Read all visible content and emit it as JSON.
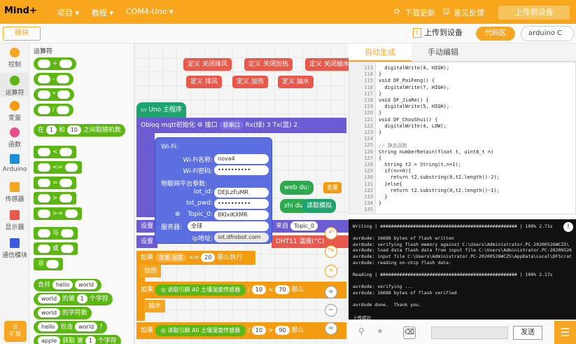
{
  "app": {
    "name": "Mind+",
    "menus": [
      "项目 ▾",
      "教程 ▾",
      "COM4-Uno ▾"
    ],
    "download_update": "下载更新",
    "feedback": "意见反馈",
    "overlay_text": "上传到设备"
  },
  "toolbar": {
    "module_tab": "模块",
    "upload_label": "上传到设备",
    "code_badge": "代码区",
    "board_select": "arduino C"
  },
  "categories": [
    {
      "label": "控制",
      "color": "#f5a623"
    },
    {
      "label": "运算符",
      "color": "#5cb712"
    },
    {
      "label": "变量",
      "color": "#f39c12"
    },
    {
      "label": "函数",
      "color": "#e84c8a"
    },
    {
      "label": "Arduino",
      "color": "#1e90d8"
    },
    {
      "label": "传感器",
      "color": "#f5a623"
    },
    {
      "label": "显示器",
      "color": "#e8594c"
    },
    {
      "label": "通信模块",
      "color": "#3b5bdb"
    }
  ],
  "palette": {
    "section_title": "运算符",
    "ops": [
      "+",
      "-",
      "*",
      "/"
    ],
    "random": {
      "pre": "在",
      "a": "1",
      "mid": "和",
      "b": "10",
      "post": "之间取随机数"
    },
    "compare": [
      "<",
      "<=",
      "=",
      ">",
      ">="
    ],
    "logic": [
      "与",
      "或",
      "非"
    ],
    "strings": {
      "join": {
        "label": "合并",
        "a": "hello",
        "b": "world"
      },
      "letter": {
        "a": "world",
        "mid": "的第",
        "n": "1",
        "post": "个字符"
      },
      "length": {
        "a": "world",
        "post": "的字符数"
      },
      "contains": {
        "a": "hello",
        "mid": "包含",
        "b": "world",
        "post": "?"
      },
      "get": {
        "a": "apple",
        "mid": "获取 第",
        "n": "1",
        "post": "个字符"
      }
    }
  },
  "workspace": {
    "defines": [
      "定义 关闭排风",
      "定义 关闭加热",
      "定义 关闭抽水",
      "定义 排风",
      "定义 加热",
      "定义 抽水"
    ],
    "main_hat": "Uno 主程序",
    "obloq": {
      "label": "Obloq mqtt初始化",
      "port": "接口",
      "serial": "软串口",
      "rx": "Rx(绿)",
      "rx_val": "3",
      "tx": "Tx(蓝)",
      "tx_val": "2"
    },
    "popup": {
      "wifi_title": "Wi-Fi:",
      "wifi_name_label": "Wi-Fi名称:",
      "wifi_name": "nova4",
      "wifi_pass_label": "Wi-Fi密码:",
      "wifi_pass": "••••••••••",
      "iot_title": "物联网平台参数:",
      "iot_id_label": "Iot_id:",
      "iot_id": "DEJLzFuMR",
      "iot_pwd_label": "Iot_pwd:",
      "iot_pwd": "••••••••••",
      "topic_label": "Topic_0:",
      "topic": "8KIxiKXMR",
      "server_label": "服务器:",
      "server": "全球",
      "ip_label": "ip地址:",
      "ip": "iot.dfrobot.com"
    },
    "side_blocks": {
      "web_du": "web du:",
      "var_badge": "变量",
      "zhi_du": "zhi du:",
      "read_analog": "读取模拟",
      "from": "来自",
      "topic0": "Topic_0",
      "dht": "DHT11",
      "temp": "温度(°C)"
    },
    "set1": "设置",
    "set2": "设置",
    "if1": {
      "pre": "如果",
      "var": "变量 温度",
      "op": "<=",
      "val": "20",
      "post": "那么执行"
    },
    "heat": "加热",
    "if2": {
      "pre": "如果",
      "read": "读取引脚",
      "pin": "A0",
      "sensor": "土壤湿度传感器",
      "div": "/",
      "d": "10",
      "op": "<",
      "val": "70",
      "post": "那么"
    },
    "pump": "抽水",
    "if3": {
      "pre": "如果",
      "read": "读取引脚",
      "pin": "A0",
      "sensor": "土壤湿度传感器",
      "div": "/",
      "d": "10",
      "op": ">",
      "val": "90",
      "post": "那么"
    }
  },
  "code_tabs": [
    "自动生成",
    "手动编辑"
  ],
  "code_lines": [
    {
      "n": "113",
      "t": "  digitalWrite(4, HIGH);"
    },
    {
      "n": "114",
      "t": "}"
    },
    {
      "n": "115",
      "t": "void DF_PaiFeng() {"
    },
    {
      "n": "116",
      "t": "  digitalWrite(7, HIGH);"
    },
    {
      "n": "117",
      "t": "}"
    },
    {
      "n": "118",
      "t": "void DF_JiaRe() {"
    },
    {
      "n": "119",
      "t": "  digitalWrite(5, HIGH);"
    },
    {
      "n": "120",
      "t": "}"
    },
    {
      "n": "121",
      "t": "void DF_ChouShui() {"
    },
    {
      "n": "122",
      "t": "  digitalWrite(4, LOW);"
    },
    {
      "n": "123",
      "t": "}"
    },
    {
      "n": "124",
      "t": ""
    },
    {
      "n": "125",
      "t": "// 静态函数"
    },
    {
      "n": "126",
      "t": "String numberRetain(float t, uint8_t n)"
    },
    {
      "n": "127",
      "t": "{"
    },
    {
      "n": "128",
      "t": "  String t2 = String(t,n+1);"
    },
    {
      "n": "129",
      "t": "  if(n<=0){"
    },
    {
      "n": "130",
      "t": "    return t2.substring(0,t2.length()-2);"
    },
    {
      "n": "131",
      "t": "  }else{"
    },
    {
      "n": "132",
      "t": "    return t2.substring(0,t2.length()-1);"
    },
    {
      "n": "133",
      "t": "  }"
    },
    {
      "n": "134",
      "t": "}"
    },
    {
      "n": "135",
      "t": ""
    }
  ],
  "serial_lines": [
    "Writing | ################################################## | 100% 2.71s",
    "",
    "avrdude: 16688 bytes of flash written",
    "avrdude: verifying flash memory against C:\\Users\\Administrator.PC-20200526WCZS\\",
    "avrdude: load data flash data from input file C:\\Users\\Administrator.PC-20200526",
    "avrdude: input file C:\\Users\\Administrator.PC-20200526WCZS\\AppData\\Local\\DFScrat",
    "avrdude: reading on-chip flash data:",
    "",
    "Reading | ################################################## | 100% 2.17s",
    "",
    "avrdude: verifying ...",
    "avrdude: 16688 bytes of flash verified",
    "",
    "avrdude done.  Thank you.",
    "",
    "上传成功"
  ],
  "serial_bar": {
    "send": "发送"
  }
}
